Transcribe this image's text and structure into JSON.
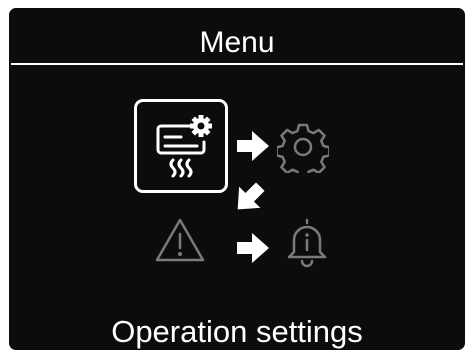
{
  "menu": {
    "title": "Menu",
    "selected_label": "Operation settings",
    "items": [
      {
        "icon": "air-conditioner-icon",
        "state": "selected"
      },
      {
        "icon": "gear-icon",
        "state": "dimmed"
      },
      {
        "icon": "warning-icon",
        "state": "dimmed"
      },
      {
        "icon": "bell-info-icon",
        "state": "dimmed"
      }
    ],
    "arrows": [
      {
        "icon": "arrow-right-icon"
      },
      {
        "icon": "arrow-down-left-icon"
      },
      {
        "icon": "arrow-right-icon"
      }
    ]
  },
  "colors": {
    "background": "#0c0c0c",
    "foreground": "#ffffff",
    "dimmed_icon": "#7a7a7a"
  }
}
